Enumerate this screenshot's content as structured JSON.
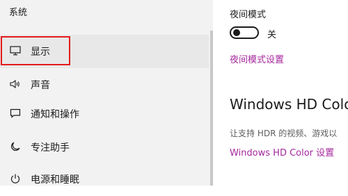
{
  "sidebar": {
    "section_title": "系统",
    "items": [
      {
        "label": "显示",
        "icon": "monitor-icon",
        "selected": true
      },
      {
        "label": "声音",
        "icon": "speaker-icon"
      },
      {
        "label": "通知和操作",
        "icon": "notification-icon"
      },
      {
        "label": "专注助手",
        "icon": "moon-icon"
      },
      {
        "label": "电源和睡眠",
        "icon": "power-icon"
      }
    ]
  },
  "main": {
    "night_mode": {
      "label": "夜间模式",
      "toggle_state": "关",
      "settings_link": "夜间模式设置"
    },
    "hd_color": {
      "title": "Windows HD Color",
      "description": "让支持 HDR 的视频、游戏以",
      "settings_link": "Windows HD Color 设置"
    }
  },
  "colors": {
    "accent_link": "#a5289e",
    "highlight_box": "#e51a1a",
    "sidebar_bg": "#f2f2f2"
  }
}
